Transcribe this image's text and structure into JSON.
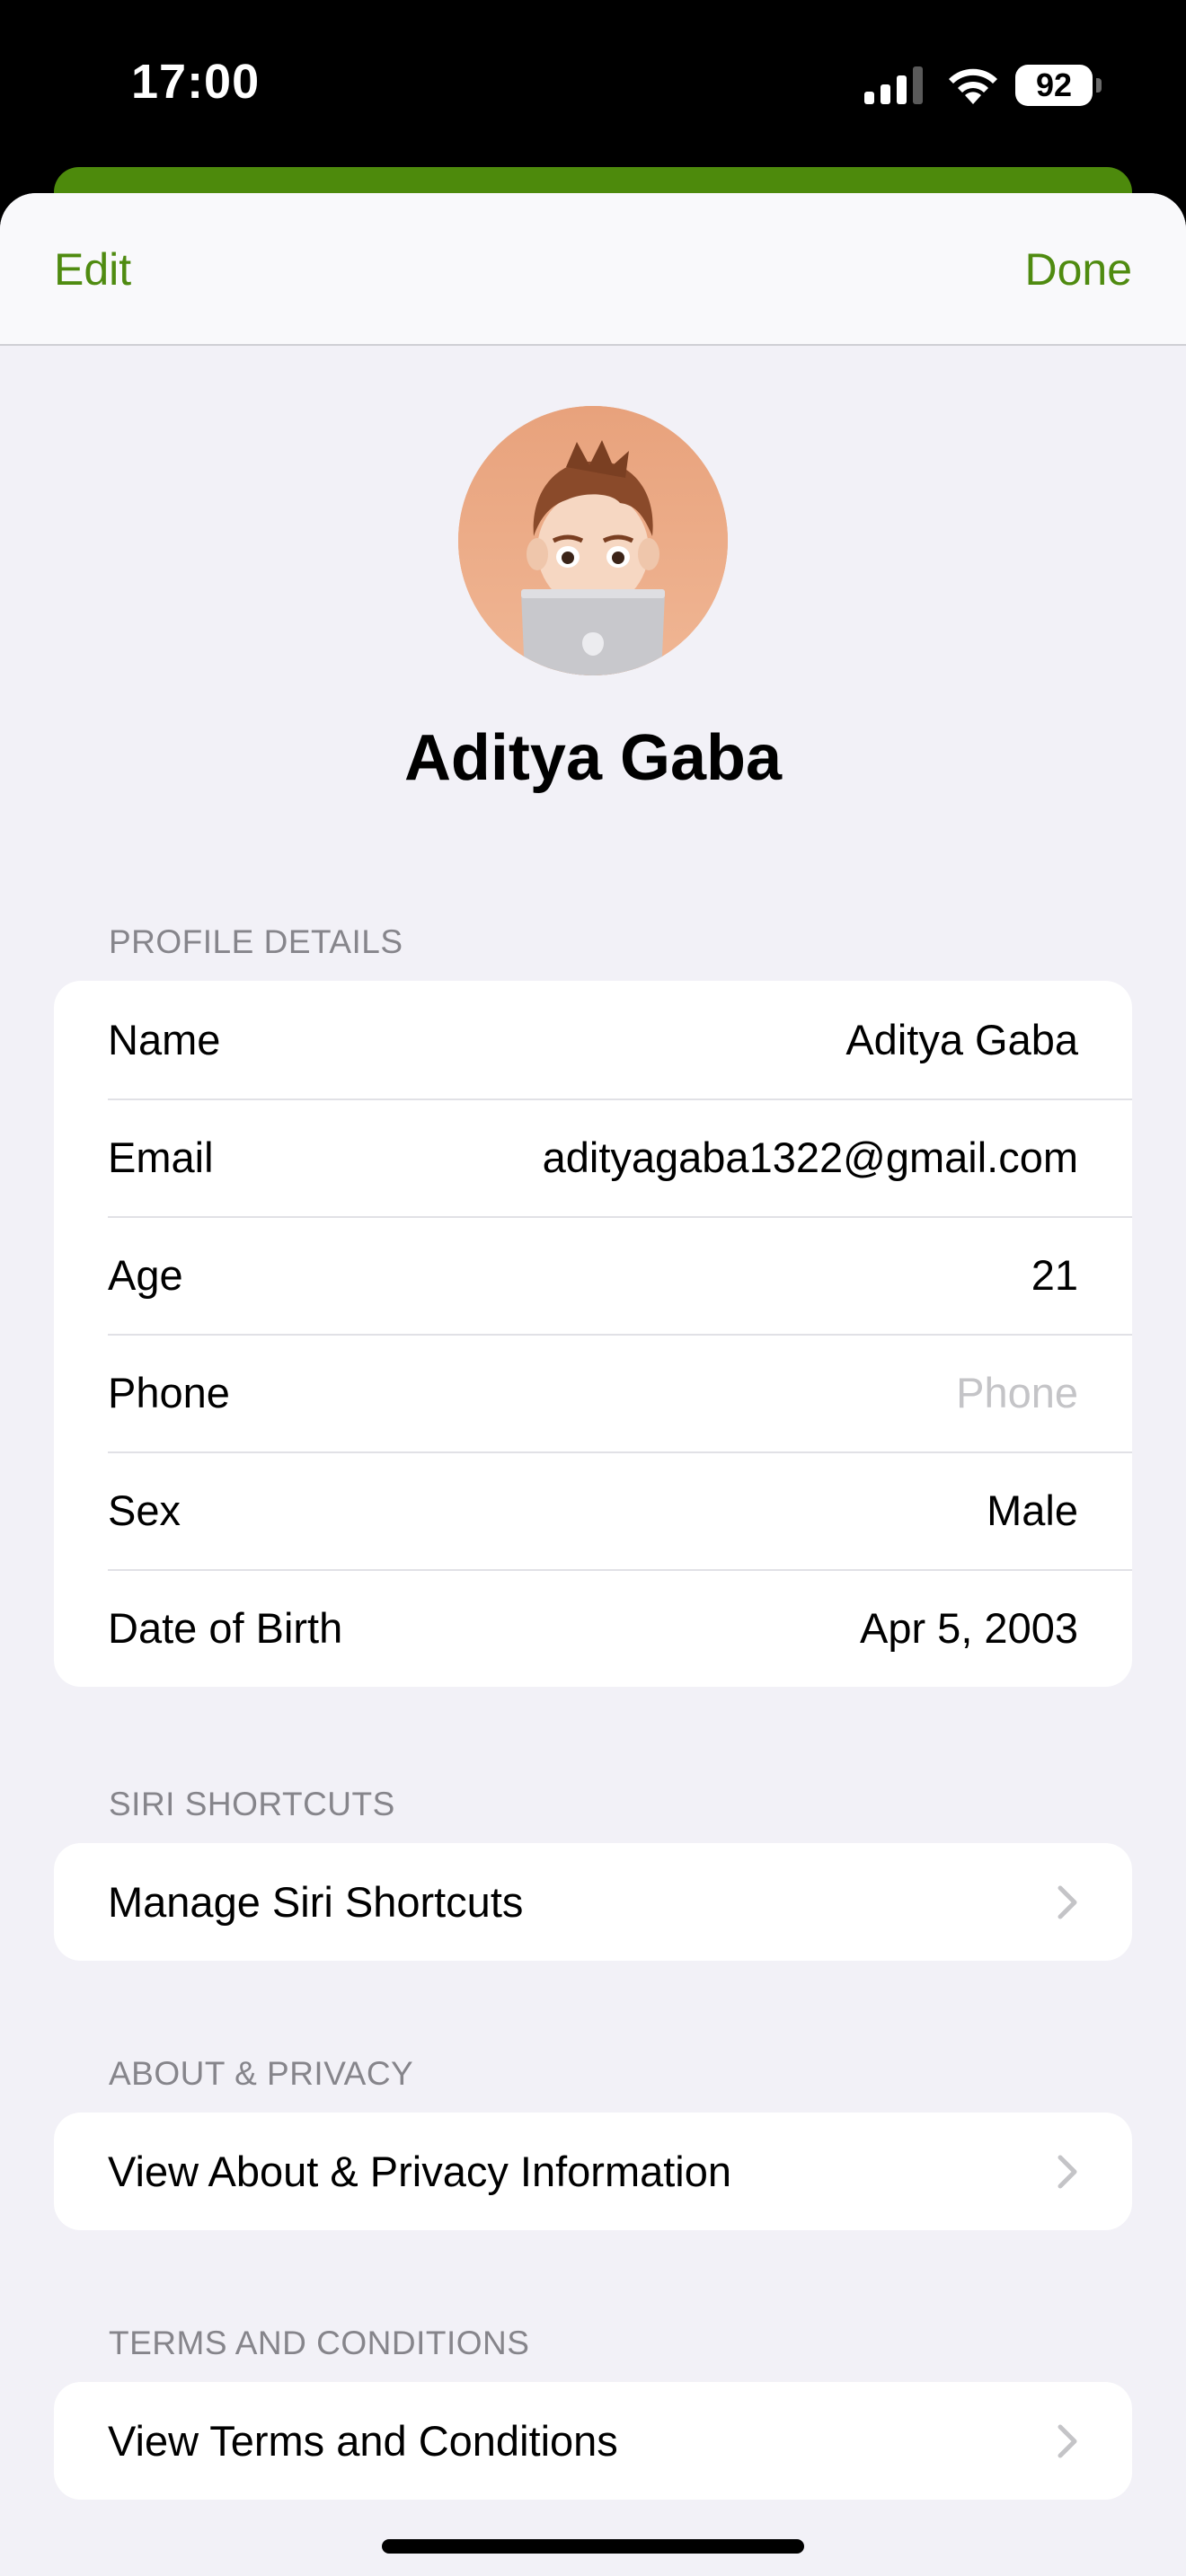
{
  "status_bar": {
    "time": "17:00",
    "battery": "92"
  },
  "nav": {
    "edit_label": "Edit",
    "done_label": "Done",
    "accent_color": "#4f8b10"
  },
  "profile": {
    "name": "Aditya Gaba",
    "avatar_icon": "memoji-avatar-icon"
  },
  "profile_details": {
    "header": "PROFILE DETAILS",
    "rows": [
      {
        "label": "Name",
        "value": "Aditya Gaba"
      },
      {
        "label": "Email",
        "value": "adityagaba1322@gmail.com"
      },
      {
        "label": "Age",
        "value": "21"
      },
      {
        "label": "Phone",
        "placeholder": "Phone"
      },
      {
        "label": "Sex",
        "value": "Male"
      },
      {
        "label": "Date of Birth",
        "value": "Apr 5, 2003"
      }
    ]
  },
  "siri_shortcuts": {
    "header": "SIRI SHORTCUTS",
    "item": "Manage Siri Shortcuts"
  },
  "about_privacy": {
    "header": "ABOUT & PRIVACY",
    "item": "View About & Privacy Information"
  },
  "terms": {
    "header": "TERMS AND CONDITIONS",
    "item": "View Terms and Conditions"
  }
}
